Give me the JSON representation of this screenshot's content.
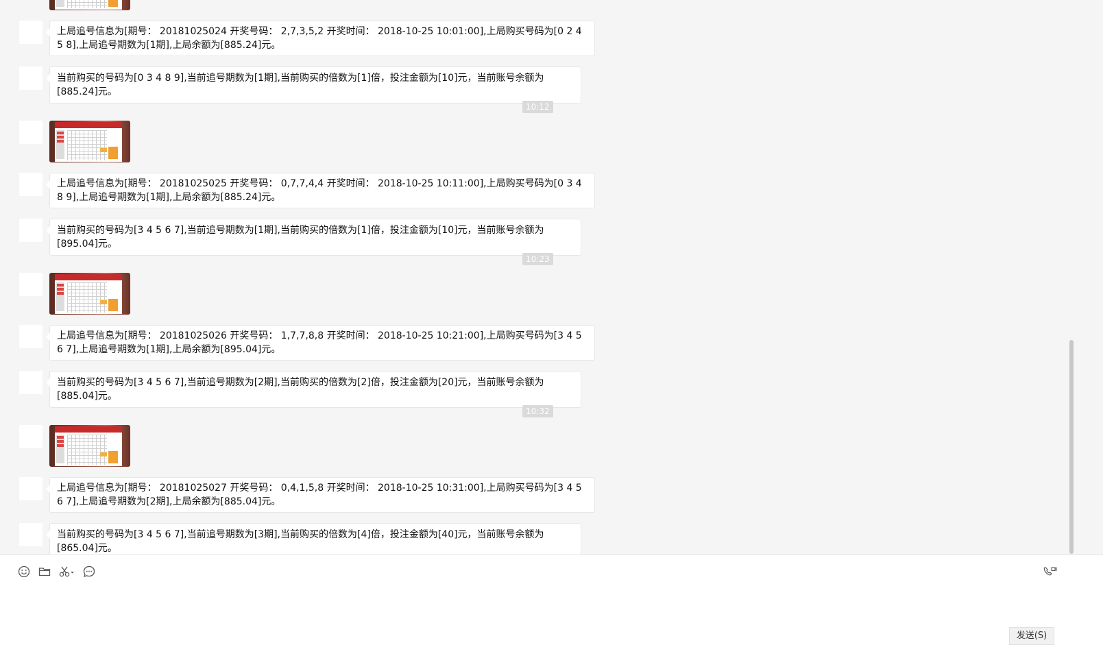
{
  "messages": [
    {
      "type": "text",
      "text": "上局追号信息为[期号： 20181025024    开奖号码： 2,7,3,5,2    开奖时间： 2018-10-25 10:01:00],上局购买号码为[0 2 4 5 8],上局追号期数为[1期],上局余额为[885.24]元。"
    },
    {
      "type": "text",
      "text": "当前购买的号码为[0 3 4 8 9],当前追号期数为[1期],当前购买的倍数为[1]倍，投注金额为[10]元，当前账号余额为[885.24]元。"
    },
    {
      "type": "time",
      "text": "10:12"
    },
    {
      "type": "text",
      "text": "上局追号信息为[期号： 20181025025    开奖号码： 0,7,7,4,4    开奖时间： 2018-10-25 10:11:00],上局购买号码为[0 3 4 8 9],上局追号期数为[1期],上局余额为[885.24]元。"
    },
    {
      "type": "text",
      "text": "当前购买的号码为[3 4 5 6 7],当前追号期数为[1期],当前购买的倍数为[1]倍，投注金额为[10]元，当前账号余额为[895.04]元。"
    },
    {
      "type": "time",
      "text": "10:23"
    },
    {
      "type": "text",
      "text": "上局追号信息为[期号： 20181025026    开奖号码： 1,7,7,8,8    开奖时间： 2018-10-25 10:21:00],上局购买号码为[3 4 5 6 7],上局追号期数为[1期],上局余额为[895.04]元。"
    },
    {
      "type": "text",
      "text": "当前购买的号码为[3 4 5 6 7],当前追号期数为[2期],当前购买的倍数为[2]倍，投注金额为[20]元，当前账号余额为[885.04]元。"
    },
    {
      "type": "time",
      "text": "10:32"
    },
    {
      "type": "text",
      "text": "上局追号信息为[期号： 20181025027    开奖号码： 0,4,1,5,8    开奖时间： 2018-10-25 10:31:00],上局购买号码为[3 4 5 6 7],上局追号期数为[2期],上局余额为[885.04]元。"
    },
    {
      "type": "text",
      "text": "当前购买的号码为[3 4 5 6 7],当前追号期数为[3期],当前购买的倍数为[4]倍，投注金额为[40]元，当前账号余额为[865.04]元。"
    }
  ],
  "toolbar": {
    "icons": [
      "emoji-icon",
      "folder-icon",
      "scissors-icon",
      "chat-history-icon"
    ],
    "call_icon": "video-call-icon"
  },
  "composer": {
    "send_label": "发送(S)"
  },
  "colors": {
    "background": "#f5f5f5",
    "bubble": "#ffffff",
    "timestamp_bg": "#dadada"
  }
}
